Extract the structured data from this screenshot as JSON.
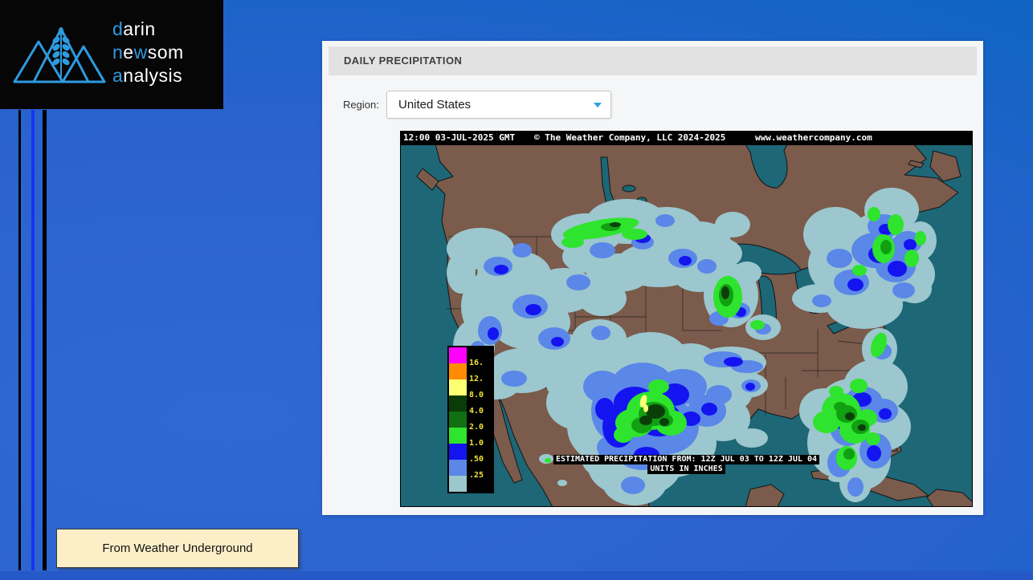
{
  "logo": {
    "word1": {
      "accent": "d",
      "rest": "arin"
    },
    "word2": {
      "accent1": "n",
      "mid": "e",
      "accent2": "w",
      "rest": "som"
    },
    "word3": {
      "accent": "a",
      "rest": "nalysis"
    }
  },
  "panel": {
    "title": "DAILY PRECIPITATION"
  },
  "region": {
    "label": "Region:",
    "value": "United States"
  },
  "map": {
    "topbar": {
      "timestamp": "12:00 03-JUL-2025 GMT",
      "copyright": "© The Weather Company, LLC 2024-2025",
      "website": "www.weathercompany.com"
    },
    "caption": {
      "line1": "ESTIMATED PRECIPITATION FROM: 12Z JUL 03 TO 12Z JUL 04",
      "line2": "UNITS IN INCHES"
    },
    "legend": {
      "labels": [
        "16.",
        "12.",
        "8.0",
        "4.0",
        "2.0",
        "1.0",
        ".50",
        ".25"
      ],
      "colors": [
        "#FF00FF",
        "#FF8C00",
        "#FFFF73",
        "#0A3C0A",
        "#117011",
        "#2EE42E",
        "#1414F0",
        "#5A87E8",
        "#9CC7CE"
      ]
    }
  },
  "attribution": {
    "label": "From Weather Underground"
  },
  "colors": {
    "accent_blue": "#2E9BE0",
    "page_bg": "#2B63CE",
    "ocean": "#1D6777",
    "land": "#7A5B4C"
  }
}
